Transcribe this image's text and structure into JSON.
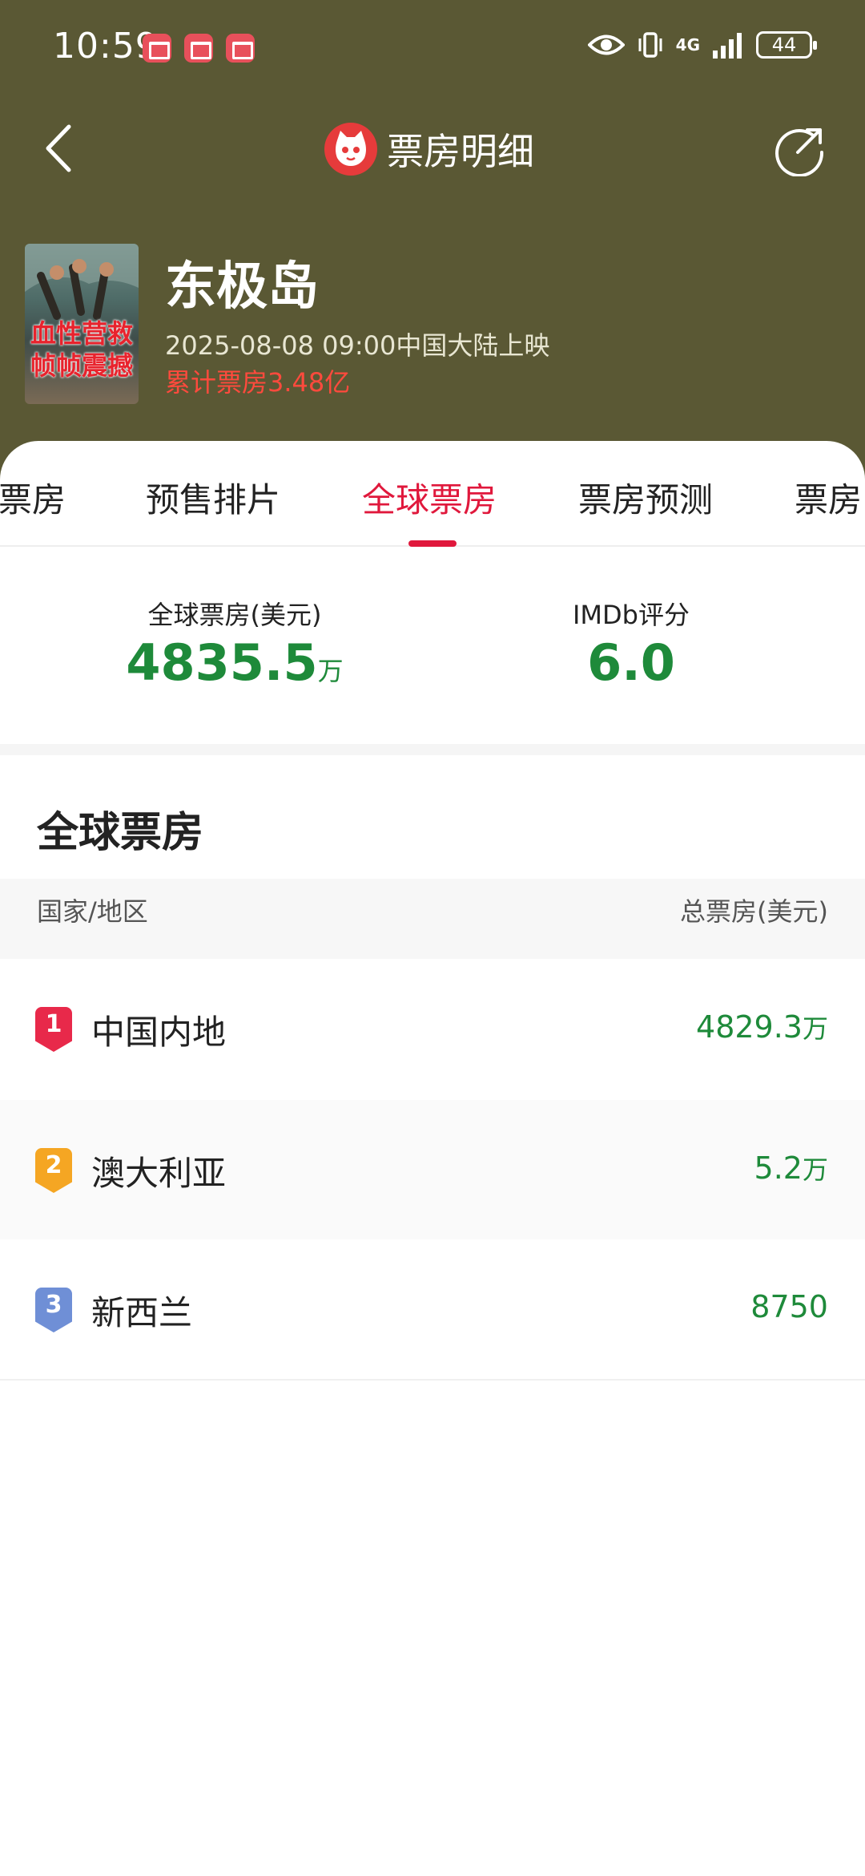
{
  "status_bar": {
    "time": "10:59",
    "network": "4G",
    "battery": "44",
    "app_icon_color": "#e8505b"
  },
  "header": {
    "title": "票房明细",
    "bg_color": "#5a5834",
    "logo_color": "#e63b3b"
  },
  "movie": {
    "title": "东极岛",
    "release": "2025-08-08 09:00中国大陆上映",
    "total_box_office": "累计票房3.48亿",
    "poster_text_line1": "血性营救",
    "poster_text_line2": "帧帧震撼"
  },
  "tabs": [
    {
      "label": "票房",
      "active": false
    },
    {
      "label": "预售排片",
      "active": false
    },
    {
      "label": "全球票房",
      "active": true
    },
    {
      "label": "票房预测",
      "active": false
    },
    {
      "label": "票房",
      "active": false
    }
  ],
  "stats": {
    "global": {
      "label": "全球票房(美元)",
      "value": "4835.5",
      "unit": "万"
    },
    "imdb": {
      "label": "IMDb评分",
      "value": "6.0"
    }
  },
  "section": {
    "title": "全球票房",
    "col_region": "国家/地区",
    "col_total": "总票房(美元)"
  },
  "rows": [
    {
      "rank": "1",
      "region": "中国内地",
      "value": "4829.3",
      "unit": "万",
      "badge_color": "#e8294a"
    },
    {
      "rank": "2",
      "region": "澳大利亚",
      "value": "5.2",
      "unit": "万",
      "badge_color": "#f5a623"
    },
    {
      "rank": "3",
      "region": "新西兰",
      "value": "8750",
      "unit": "",
      "badge_color": "#6f8fd6"
    }
  ],
  "colors": {
    "accent": "#e0183c",
    "value_green": "#1e8a3a"
  }
}
